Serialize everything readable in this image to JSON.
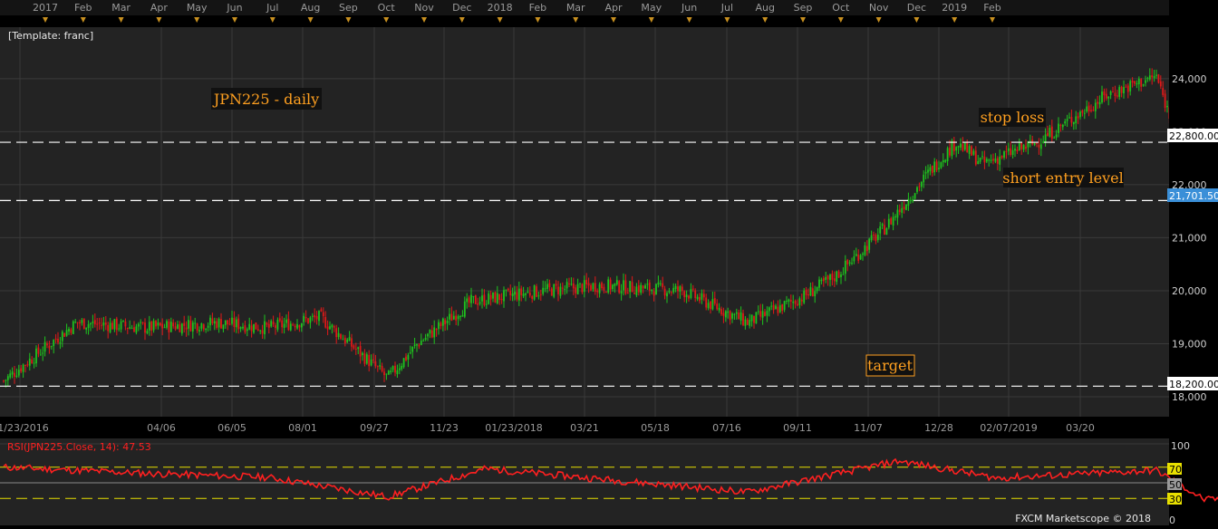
{
  "template_label": "[Template: franc]",
  "timeline": {
    "labels": [
      "2017",
      "Feb",
      "Mar",
      "Apr",
      "May",
      "Jun",
      "Jul",
      "Aug",
      "Sep",
      "Oct",
      "Nov",
      "Dec",
      "2018",
      "Feb",
      "Mar",
      "Apr",
      "May",
      "Jun",
      "Jul",
      "Aug",
      "Sep",
      "Oct",
      "Nov",
      "Dec",
      "2019",
      "Feb"
    ]
  },
  "annotations": {
    "title": "JPN225 - daily",
    "stop_loss": "stop loss",
    "short_entry": "short entry level",
    "target": "target"
  },
  "price_tags": {
    "stop_loss": "22,800.00",
    "current": "21,701.50",
    "target": "18,200.00"
  },
  "rsi_panel": {
    "label": "RSI(JPN225.Close, 14): 47.53",
    "levels": [
      "100",
      "70",
      "50",
      "30",
      "0"
    ]
  },
  "watermark": "FXCM Marketscope © 2018",
  "colors": {
    "up": "#1ec41e",
    "down": "#e01818",
    "rsi_line": "#ff2020",
    "annotation_text": "#ffa020",
    "current_tag": "#3a8fd8",
    "guide_yellow": "#e8e000"
  },
  "chart_data": [
    {
      "type": "candlestick",
      "title": "JPN225 - daily",
      "ylim": [
        18000,
        24800
      ],
      "y_ticks": [
        "18,000",
        "19,000",
        "20,000",
        "21,000",
        "22,000",
        "23,000",
        "24,000"
      ],
      "x_tick_labels": [
        "11/23/2016",
        "04/06",
        "06/05",
        "08/01",
        "09/27",
        "11/23",
        "01/23/2018",
        "03/21",
        "05/18",
        "07/16",
        "09/11",
        "11/07",
        "12/28",
        "02/07/2019",
        "03/20"
      ],
      "horizontal_levels": [
        {
          "name": "stop loss",
          "value": 22800
        },
        {
          "name": "short entry level",
          "value": 21701.5
        },
        {
          "name": "target",
          "value": 18200
        }
      ],
      "path_points": [
        [
          "2016-11-23",
          18300
        ],
        [
          "2016-12-20",
          19400
        ],
        [
          "2017-01-15",
          19300
        ],
        [
          "2017-02-10",
          19400
        ],
        [
          "2017-03-01",
          19300
        ],
        [
          "2017-03-20",
          19500
        ],
        [
          "2017-04-14",
          18350
        ],
        [
          "2017-04-25",
          19000
        ],
        [
          "2017-05-15",
          19800
        ],
        [
          "2017-06-10",
          20000
        ],
        [
          "2017-07-01",
          20100
        ],
        [
          "2017-08-01",
          20000
        ],
        [
          "2017-08-25",
          19400
        ],
        [
          "2017-09-15",
          19900
        ],
        [
          "2017-09-27",
          20300
        ],
        [
          "2017-10-15",
          21200
        ],
        [
          "2017-11-01",
          22300
        ],
        [
          "2017-11-10",
          22800
        ],
        [
          "2017-11-20",
          22400
        ],
        [
          "2017-12-10",
          22800
        ],
        [
          "2018-01-05",
          23700
        ],
        [
          "2018-01-23",
          24050
        ],
        [
          "2018-02-06",
          21900
        ],
        [
          "2018-02-20",
          21800
        ],
        [
          "2018-03-05",
          21500
        ],
        [
          "2018-03-25",
          20700
        ],
        [
          "2018-04-10",
          21600
        ],
        [
          "2018-05-01",
          22500
        ],
        [
          "2018-05-21",
          22950
        ],
        [
          "2018-06-10",
          22500
        ],
        [
          "2018-07-01",
          22000
        ],
        [
          "2018-07-16",
          22600
        ],
        [
          "2018-08-10",
          22500
        ],
        [
          "2018-08-25",
          22400
        ],
        [
          "2018-09-10",
          22800
        ],
        [
          "2018-09-25",
          23900
        ],
        [
          "2018-10-02",
          24200
        ],
        [
          "2018-10-10",
          23400
        ],
        [
          "2018-10-25",
          21200
        ],
        [
          "2018-11-07",
          22100
        ],
        [
          "2018-11-20",
          21600
        ],
        [
          "2018-12-04",
          22400
        ],
        [
          "2018-12-18",
          21500
        ],
        [
          "2018-12-20",
          21700
        ]
      ]
    },
    {
      "type": "line",
      "title": "RSI(JPN225.Close, 14): 47.53",
      "ylim": [
        0,
        100
      ],
      "reference_levels": [
        70,
        50,
        30
      ],
      "last_value": 47.53,
      "path_points": [
        [
          "2016-11-23",
          70
        ],
        [
          "2017-01-15",
          62
        ],
        [
          "2017-03-01",
          57
        ],
        [
          "2017-04-14",
          32
        ],
        [
          "2017-05-20",
          68
        ],
        [
          "2017-07-01",
          55
        ],
        [
          "2017-08-25",
          38
        ],
        [
          "2017-10-20",
          78
        ],
        [
          "2017-11-25",
          56
        ],
        [
          "2018-01-23",
          66
        ],
        [
          "2018-02-10",
          28
        ],
        [
          "2018-03-25",
          37
        ],
        [
          "2018-05-20",
          65
        ],
        [
          "2018-06-20",
          48
        ],
        [
          "2018-08-10",
          58
        ],
        [
          "2018-09-05",
          52
        ],
        [
          "2018-10-02",
          72
        ],
        [
          "2018-10-25",
          32
        ],
        [
          "2018-11-15",
          55
        ],
        [
          "2018-12-20",
          47.53
        ]
      ]
    }
  ]
}
